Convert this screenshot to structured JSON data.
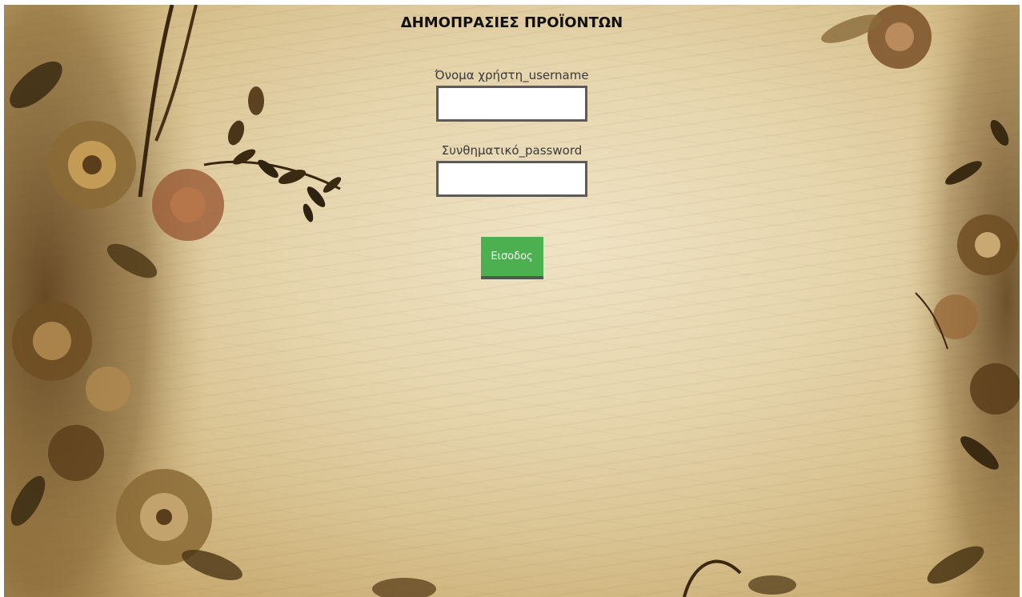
{
  "page": {
    "title": "ΔΗΜΟΠΡΑΣΙΕΣ ΠΡΟΪΟΝΤΩΝ"
  },
  "login_form": {
    "username_label": "Όνομα χρήστη_username",
    "username_value": "",
    "password_label": "Συνθηματικό_password",
    "password_value": "",
    "submit_label": "Εισοδος"
  },
  "colors": {
    "submit_button": "#4caf50",
    "submit_shadow": "#4d5a4e",
    "field_border": "#5b5b5b",
    "background_paper": "#e6d5ad"
  },
  "icons": {
    "background": "floral-parchment-background"
  }
}
